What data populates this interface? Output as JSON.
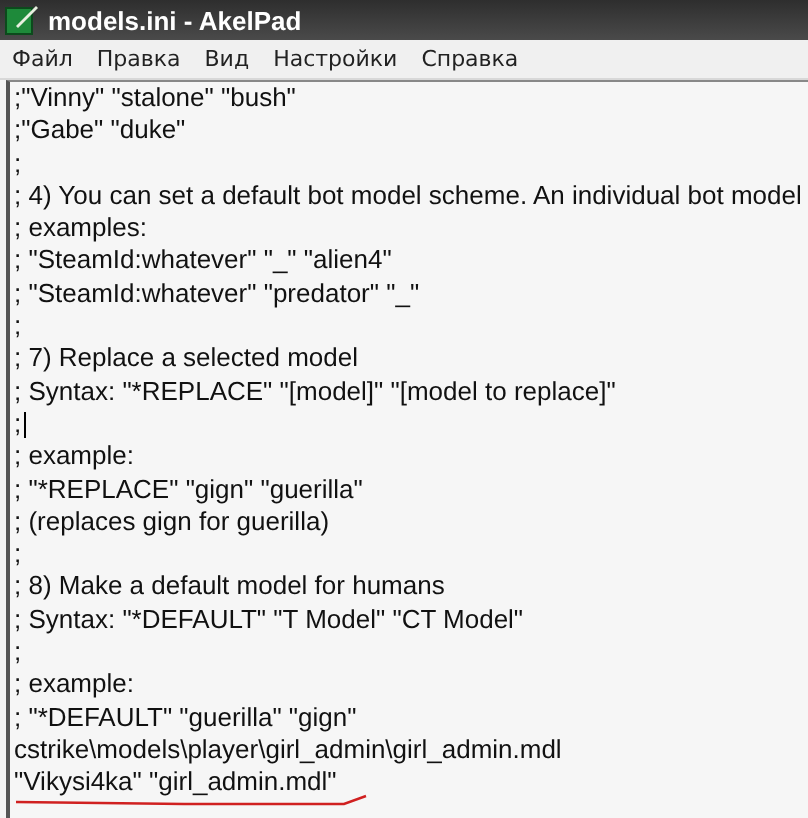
{
  "window": {
    "title": "models.ini - AkelPad"
  },
  "menu": [
    {
      "label": "Файл"
    },
    {
      "label": "Правка"
    },
    {
      "label": "Вид"
    },
    {
      "label": "Настройки"
    },
    {
      "label": "Справка"
    }
  ],
  "editor": {
    "lines": [
      {
        "text": ";\"Vinny\" \"stalone\" \"bush\"",
        "caret": false
      },
      {
        "text": ";\"Gabe\" \"duke\"",
        "caret": false
      },
      {
        "text": ";",
        "caret": false
      },
      {
        "text": "; 4) You can set a default bot model scheme. An individual bot model",
        "caret": false
      },
      {
        "text": "; examples:",
        "caret": false
      },
      {
        "text": "; \"SteamId:whatever\" \"_\" \"alien4\"",
        "caret": false
      },
      {
        "text": "; \"SteamId:whatever\" \"predator\" \"_\"",
        "caret": false
      },
      {
        "text": ";",
        "caret": false
      },
      {
        "text": "; 7) Replace a selected model",
        "caret": false
      },
      {
        "text": "; Syntax: \"*REPLACE\" \"[model]\" \"[model to replace]\"",
        "caret": false
      },
      {
        "text": ";",
        "caret": true
      },
      {
        "text": "; example:",
        "caret": false
      },
      {
        "text": "; \"*REPLACE\" \"gign\" \"guerilla\"",
        "caret": false
      },
      {
        "text": "; (replaces gign for guerilla)",
        "caret": false
      },
      {
        "text": ";",
        "caret": false
      },
      {
        "text": "; 8) Make a default model for humans",
        "caret": false
      },
      {
        "text": "; Syntax: \"*DEFAULT\" \"T Model\" \"CT Model\"",
        "caret": false
      },
      {
        "text": ";",
        "caret": false
      },
      {
        "text": "; example:",
        "caret": false
      },
      {
        "text": "; \"*DEFAULT\" \"guerilla\" \"gign\"",
        "caret": false
      },
      {
        "text": "cstrike\\models\\player\\girl_admin\\girl_admin.mdl",
        "caret": false
      },
      {
        "text": "\"Vikysi4ka\" \"girl_admin.mdl\"",
        "caret": false,
        "underlined": true
      }
    ]
  }
}
